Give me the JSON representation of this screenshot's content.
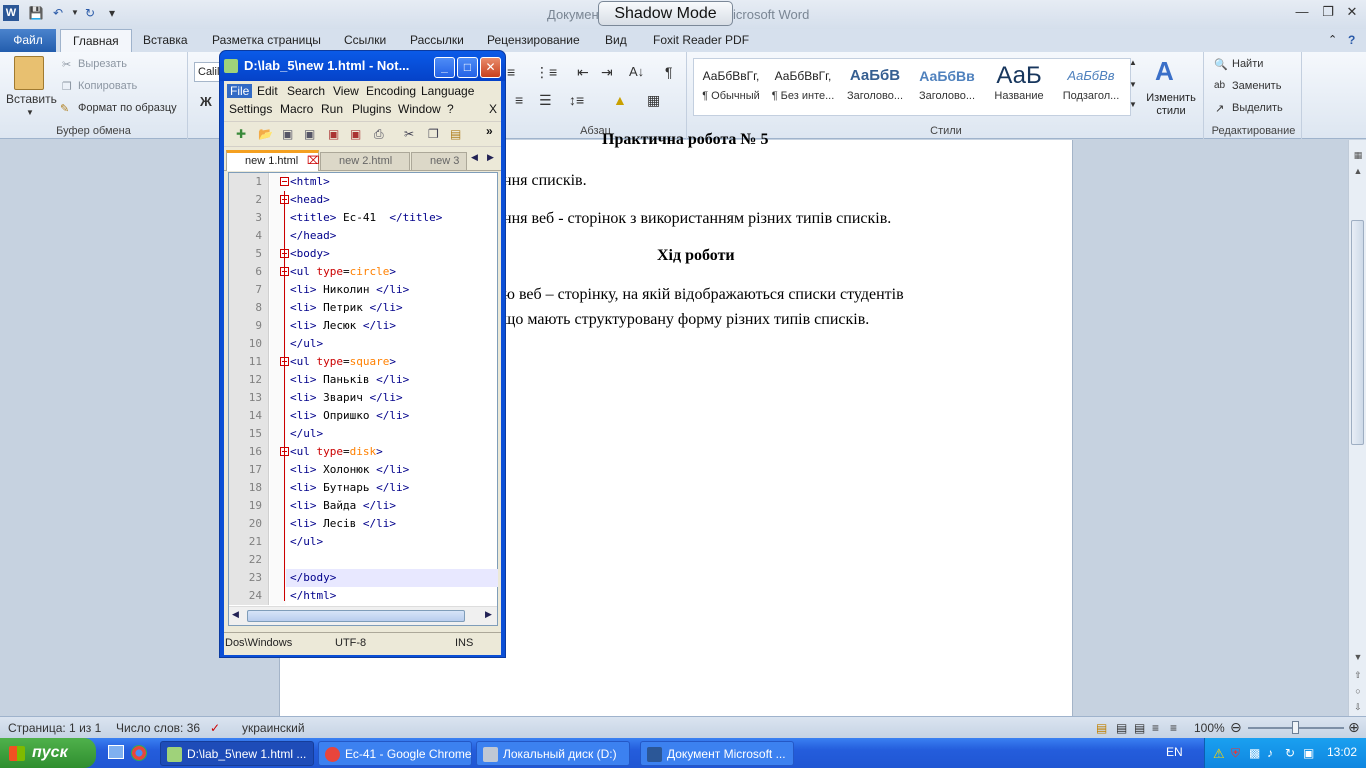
{
  "word": {
    "title_left": "Докумен",
    "title_right": "icrosoft Word",
    "shadow_mode": "Shadow Mode",
    "tabs": [
      "Файл",
      "Главная",
      "Вставка",
      "Разметка страницы",
      "Ссылки",
      "Рассылки",
      "Рецензирование",
      "Вид",
      "Foxit Reader PDF"
    ],
    "clipboard": {
      "paste": "Вставить",
      "cut": "Вырезать",
      "copy": "Копировать",
      "format": "Формат по образцу",
      "label": "Буфер обмена"
    },
    "font": {
      "name": "Calil",
      "bold": "Ж"
    },
    "paragraph_label": "Абзац",
    "styles": [
      {
        "preview": "АаБбВвГг,",
        "name": "¶ Обычный"
      },
      {
        "preview": "АаБбВвГг,",
        "name": "¶ Без инте..."
      },
      {
        "preview": "АаБбВ",
        "name": "Заголово..."
      },
      {
        "preview": "АаБбВв",
        "name": "Заголово..."
      },
      {
        "preview": "АаБ",
        "name": "Название"
      },
      {
        "preview": "АаБбВв",
        "name": "Подзагол..."
      }
    ],
    "change_styles": "Изменить стили",
    "styles_label": "Стили",
    "editing": {
      "find": "Найти",
      "replace": "Заменить",
      "select": "Выделить",
      "label": "Редактирование"
    },
    "document": {
      "line0": "Практична робота № 5",
      "line1": "ння списків.",
      "line2": "ння веб - сторінок з використанням  різних типів списків.",
      "heading": "Хід роботи",
      "line3": "ю веб – сторінку, на якій відображаються списки студентів",
      "line4": "що мають структуровану форму різних типів списків."
    },
    "status": {
      "page": "Страница: 1 из 1",
      "words": "Число слов: 36",
      "lang": "украинский",
      "zoom": "100%"
    }
  },
  "npp": {
    "title": "D:\\lab_5\\new  1.html - Not...",
    "menus1": [
      "File",
      "Edit",
      "Search",
      "View",
      "Encoding",
      "Language"
    ],
    "menus2": [
      "Settings",
      "Macro",
      "Run",
      "Plugins",
      "Window",
      "?"
    ],
    "close_x": "X",
    "tabs": [
      "new  1.html",
      "new  2.html",
      "new  3"
    ],
    "lines": [
      {
        "n": "1",
        "t": "<html>"
      },
      {
        "n": "2",
        "t": "<head>"
      },
      {
        "n": "3",
        "t": "<title> Ес-41  </title>"
      },
      {
        "n": "4",
        "t": "</head>"
      },
      {
        "n": "5",
        "t": "<body>"
      },
      {
        "n": "6",
        "t": "<ul type=circle>"
      },
      {
        "n": "7",
        "t": "<li> Николин </li>"
      },
      {
        "n": "8",
        "t": "<li> Петрик </li>"
      },
      {
        "n": "9",
        "t": "<li> Лесюк </li>"
      },
      {
        "n": "10",
        "t": "</ul>"
      },
      {
        "n": "11",
        "t": "<ul type=square>"
      },
      {
        "n": "12",
        "t": "<li> Паньків </li>"
      },
      {
        "n": "13",
        "t": "<li> Зварич </li>"
      },
      {
        "n": "14",
        "t": "<li> Опришко </li>"
      },
      {
        "n": "15",
        "t": "</ul>"
      },
      {
        "n": "16",
        "t": "<ul type=disk>"
      },
      {
        "n": "17",
        "t": "<li> Холонюк </li>"
      },
      {
        "n": "18",
        "t": "<li> Бутнарь </li>"
      },
      {
        "n": "19",
        "t": "<li> Вайда </li>"
      },
      {
        "n": "20",
        "t": "<li> Лесів </li>"
      },
      {
        "n": "21",
        "t": "</ul>"
      },
      {
        "n": "22",
        "t": ""
      },
      {
        "n": "23",
        "t": "</body>"
      },
      {
        "n": "24",
        "t": "</html>"
      }
    ],
    "status": {
      "eol": "Dos\\Windows",
      "enc": "UTF-8",
      "mode": "INS"
    }
  },
  "taskbar": {
    "start": "пуск",
    "items": [
      "D:\\lab_5\\new  1.html ...",
      "Ес-41 - Google Chrome",
      "Локальный диск (D:)",
      "Документ Microsoft ..."
    ],
    "lang": "EN",
    "time": "13:02"
  }
}
